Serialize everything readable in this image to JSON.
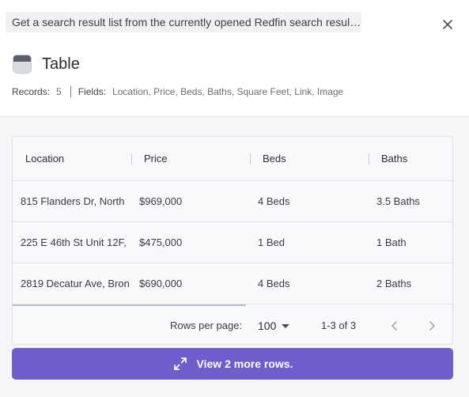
{
  "task": {
    "text": "Get a search result list from the currently opened Redfin search results page"
  },
  "header": {
    "title": "Table",
    "records_label": "Records:",
    "records_value": "5",
    "fields_label": "Fields:",
    "fields_value": "Location, Price, Beds, Baths, Square Feet, Link, Image"
  },
  "table": {
    "columns": [
      "Location",
      "Price",
      "Beds",
      "Baths"
    ],
    "rows": [
      [
        "815 Flanders Dr, North",
        "$969,000",
        "4 Beds",
        "3.5 Baths"
      ],
      [
        "225 E 46th St Unit 12F,",
        "$475,000",
        "1 Bed",
        "1 Bath"
      ],
      [
        "2819 Decatur Ave, Bron",
        "$690,000",
        "4 Beds",
        "2 Baths"
      ]
    ]
  },
  "pagination": {
    "rows_per_page_label": "Rows per page:",
    "rows_per_page_value": "100",
    "range_text": "1-3 of 3"
  },
  "actions": {
    "view_more_label": "View 2 more rows."
  },
  "colors": {
    "accent": "#6e5fcd"
  },
  "icons": {
    "close": "close-icon",
    "table": "table-icon",
    "caret": "caret-down-icon",
    "prev": "chevron-left-icon",
    "next": "chevron-right-icon",
    "expand": "expand-icon"
  }
}
